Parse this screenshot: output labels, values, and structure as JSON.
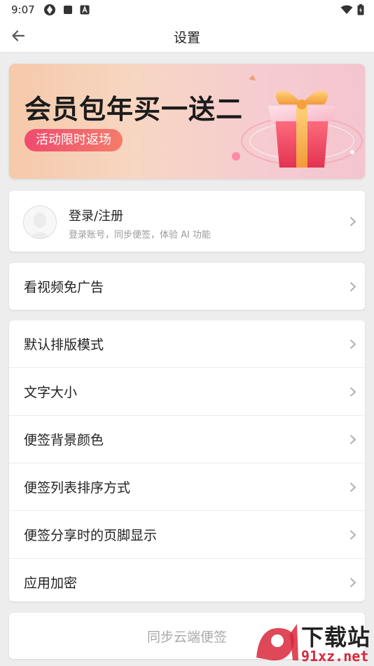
{
  "status_bar": {
    "time": "9:07"
  },
  "app_bar": {
    "title": "设置"
  },
  "banner": {
    "title": "会员包年买一送二",
    "pill": "活动限时返场"
  },
  "login": {
    "title": "登录/注册",
    "subtitle": "登录账号，同步便签，体验 AI 功能"
  },
  "ad_row": {
    "label": "看视频免广告"
  },
  "settings": {
    "items": [
      {
        "label": "默认排版模式"
      },
      {
        "label": "文字大小"
      },
      {
        "label": "便签背景颜色"
      },
      {
        "label": "便签列表排序方式"
      },
      {
        "label": "便签分享时的页脚显示"
      },
      {
        "label": "应用加密"
      }
    ]
  },
  "sync": {
    "label": "同步云端便签"
  },
  "watermark": {
    "text": "下载站",
    "url": "91xz.net"
  }
}
